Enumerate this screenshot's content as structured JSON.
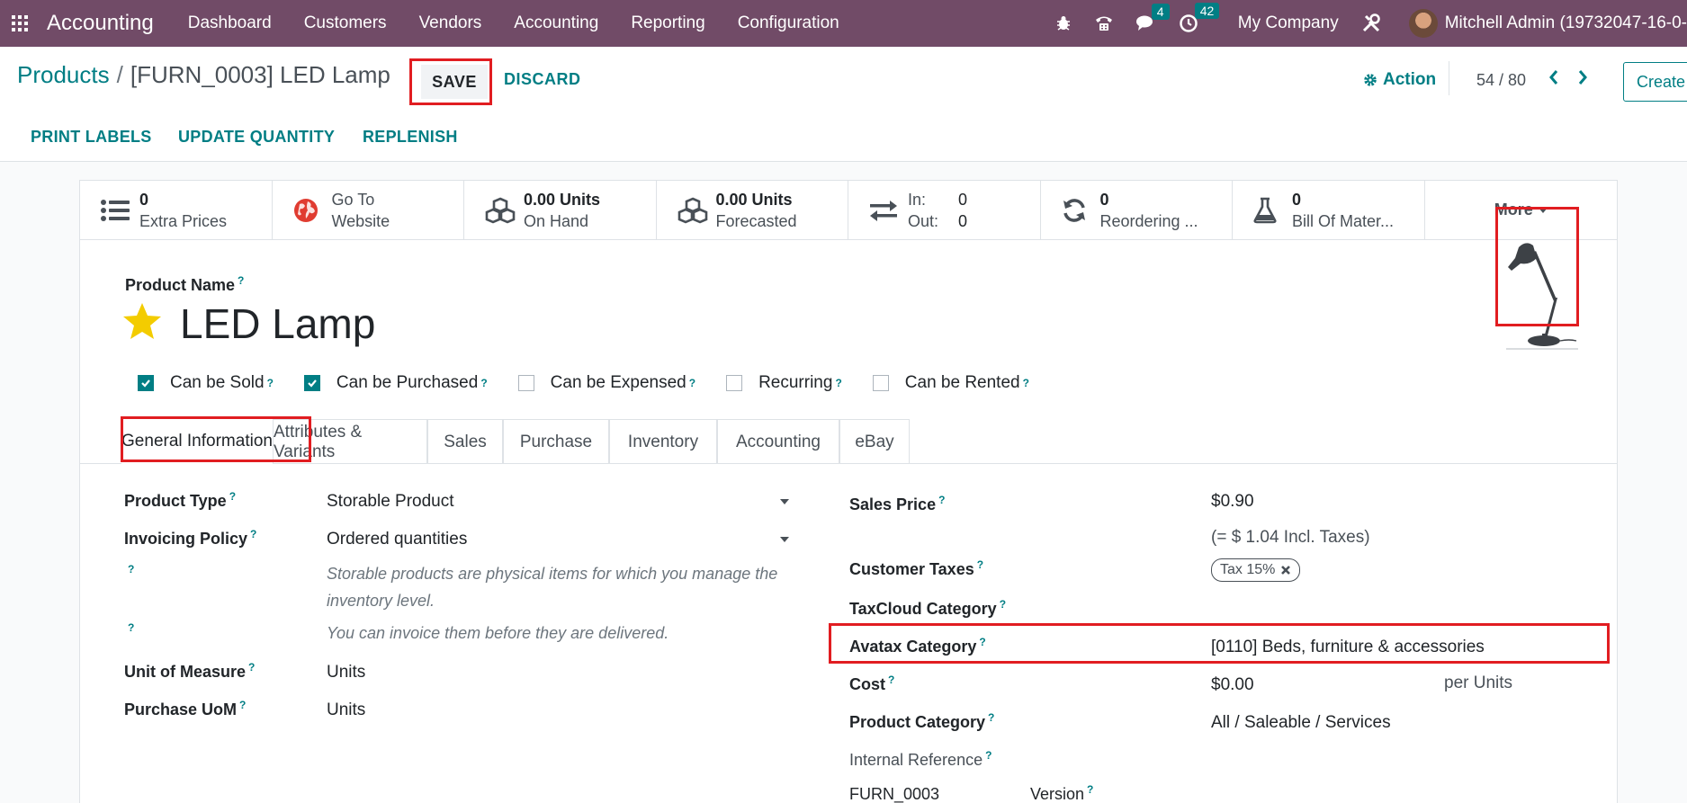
{
  "navbar": {
    "brand": "Accounting",
    "menu": [
      "Dashboard",
      "Customers",
      "Vendors",
      "Accounting",
      "Reporting",
      "Configuration"
    ],
    "chat_count": "4",
    "activity_count": "42",
    "company": "My Company",
    "user": "Mitchell Admin (19732047-16-0-"
  },
  "control": {
    "breadcrumb_parent": "Products",
    "breadcrumb_sep": "/",
    "breadcrumb_current": "[FURN_0003] LED Lamp",
    "save": "SAVE",
    "discard": "DISCARD",
    "action": "Action",
    "pager": "54 / 80",
    "create": "Create",
    "print_labels": "PRINT LABELS",
    "update_quantity": "UPDATE QUANTITY",
    "replenish": "REPLENISH"
  },
  "smart_buttons": {
    "extra_prices": {
      "num": "0",
      "label": "Extra Prices"
    },
    "website": {
      "line1": "Go To",
      "line2": "Website"
    },
    "on_hand": {
      "num": "0.00 Units",
      "label": "On Hand"
    },
    "forecasted": {
      "num": "0.00 Units",
      "label": "Forecasted"
    },
    "in_out": {
      "in_label": "In:",
      "in_val": "0",
      "out_label": "Out:",
      "out_val": "0"
    },
    "reordering": {
      "num": "0",
      "label": "Reordering ..."
    },
    "bom": {
      "num": "0",
      "label": "Bill Of Mater..."
    },
    "more": "More"
  },
  "form": {
    "product_name_label": "Product Name",
    "product_name": "LED Lamp",
    "checkboxes": [
      {
        "label": "Can be Sold",
        "checked": true
      },
      {
        "label": "Can be Purchased",
        "checked": true
      },
      {
        "label": "Can be Expensed",
        "checked": false
      },
      {
        "label": "Recurring",
        "checked": false
      },
      {
        "label": "Can be Rented",
        "checked": false
      }
    ],
    "tabs": [
      "General Information",
      "Attributes & Variants",
      "Sales",
      "Purchase",
      "Inventory",
      "Accounting",
      "eBay"
    ],
    "q": "?",
    "left": {
      "product_type_label": "Product Type",
      "product_type": "Storable Product",
      "invoicing_policy_label": "Invoicing Policy",
      "invoicing_policy": "Ordered quantities",
      "hint1": "Storable products are physical items for which you manage the inventory level.",
      "hint2": "You can invoice them before they are delivered.",
      "uom_label": "Unit of Measure",
      "uom": "Units",
      "purchase_uom_label": "Purchase UoM",
      "purchase_uom": "Units"
    },
    "right": {
      "sales_price_label": "Sales Price",
      "sales_price": "$0.90",
      "incl_taxes": "(= $ 1.04 Incl. Taxes)",
      "customer_taxes_label": "Customer Taxes",
      "tax_tag": "Tax 15%",
      "taxcloud_label": "TaxCloud Category",
      "avatax_label": "Avatax Category",
      "avatax": "[0110] Beds, furniture & accessories",
      "cost_label": "Cost",
      "cost": "$0.00",
      "cost_unit": "per Units",
      "category_label": "Product Category",
      "category": "All / Saleable / Services",
      "internal_ref_label": "Internal Reference",
      "internal_ref": "FURN_0003",
      "version_label": "Version"
    }
  },
  "colors": {
    "brand": "#714b67",
    "accent": "#017e84",
    "highlight": "#e11d21"
  }
}
